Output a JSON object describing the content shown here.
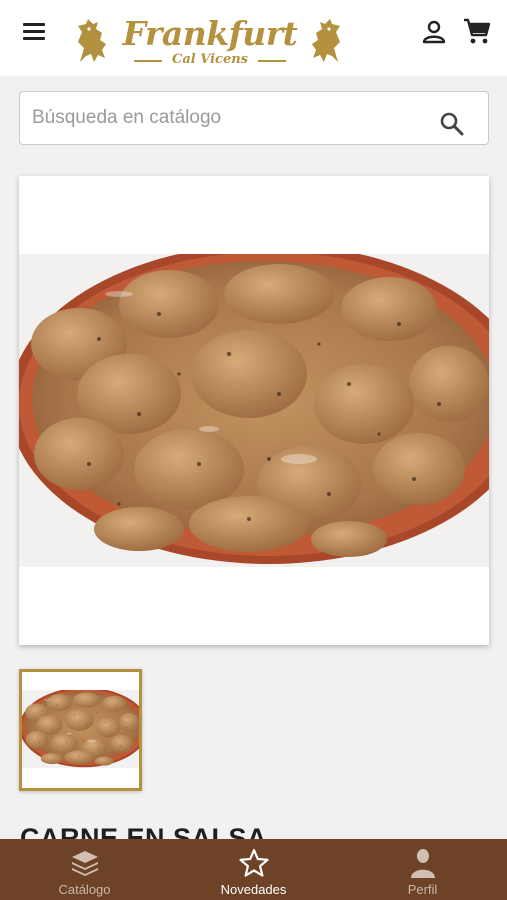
{
  "header": {
    "menu_icon": "hamburger-menu-icon",
    "logo": {
      "title": "Frankfurt",
      "subtitle": "Cal Vicens",
      "color": "#b4913e"
    },
    "user_icon": "user-icon",
    "cart_icon": "shopping-cart-icon"
  },
  "search": {
    "placeholder": "Búsqueda en catálogo",
    "icon": "search-icon"
  },
  "product": {
    "title": "CARNE EN SALSA",
    "image": "meat-in-sauce-clay-dish",
    "thumbnail_selected": true
  },
  "bottom_nav": {
    "background": "#6e4226",
    "items": [
      {
        "label": "Catálogo",
        "icon": "layers-icon",
        "active": false
      },
      {
        "label": "Novedades",
        "icon": "star-icon",
        "active": true
      },
      {
        "label": "Perfil",
        "icon": "person-icon",
        "active": false
      }
    ]
  }
}
